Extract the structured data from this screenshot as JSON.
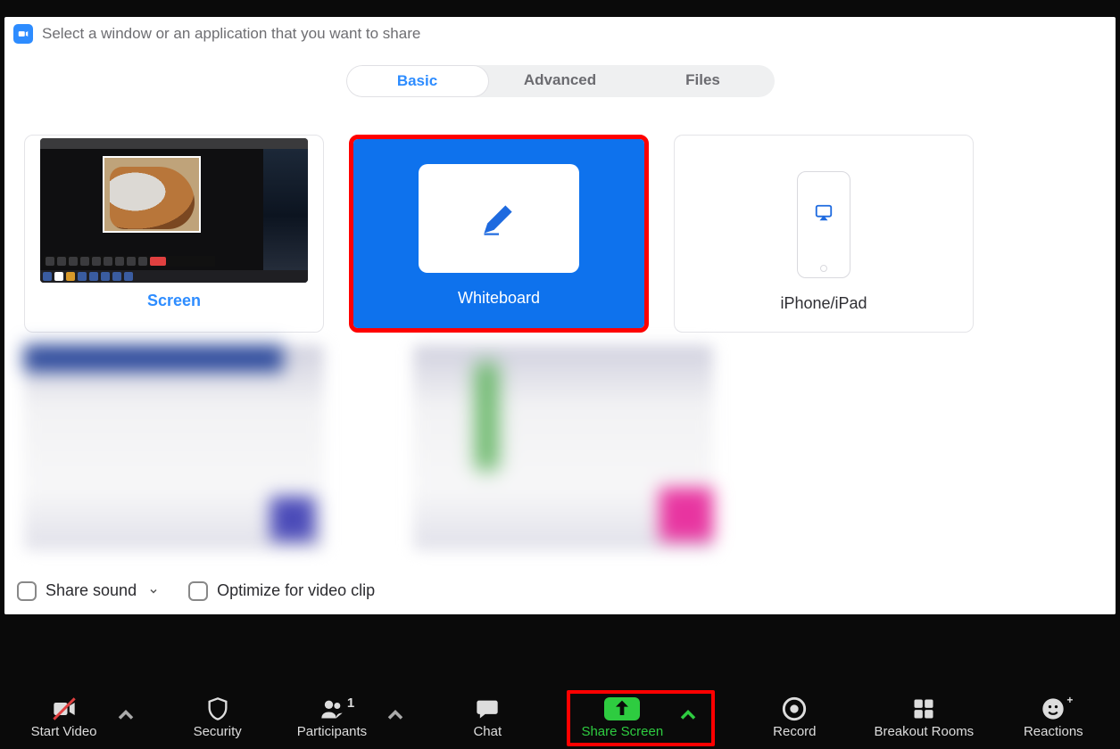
{
  "dialog": {
    "title": "Select a window or an application that you want to share",
    "tabs": {
      "basic": "Basic",
      "advanced": "Advanced",
      "files": "Files"
    },
    "options": {
      "screen": "Screen",
      "whiteboard": "Whiteboard",
      "iphone": "iPhone/iPad"
    },
    "footer": {
      "share_sound": "Share sound",
      "optimize": "Optimize for video clip"
    }
  },
  "meeting_bar": {
    "start_video": "Start Video",
    "security": "Security",
    "participants": "Participants",
    "participant_count": "1",
    "chat": "Chat",
    "share_screen": "Share Screen",
    "record": "Record",
    "breakout": "Breakout Rooms",
    "reactions": "Reactions"
  }
}
